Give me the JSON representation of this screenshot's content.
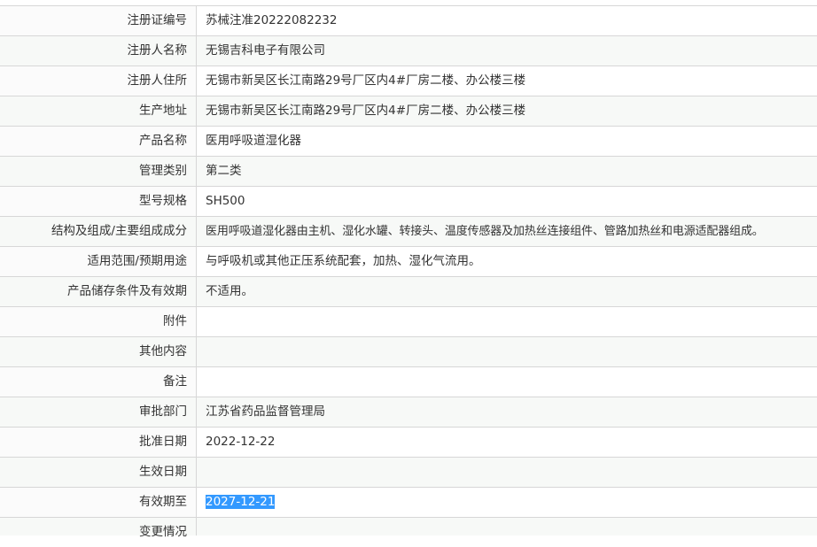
{
  "rows": [
    {
      "label": "注册证编号",
      "value": "苏械注准20222082232"
    },
    {
      "label": "注册人名称",
      "value": "无锡吉科电子有限公司"
    },
    {
      "label": "注册人住所",
      "value": "无锡市新吴区长江南路29号厂区内4#厂房二楼、办公楼三楼"
    },
    {
      "label": "生产地址",
      "value": "无锡市新吴区长江南路29号厂区内4#厂房二楼、办公楼三楼"
    },
    {
      "label": "产品名称",
      "value": "医用呼吸道湿化器"
    },
    {
      "label": "管理类别",
      "value": "第二类"
    },
    {
      "label": "型号规格",
      "value": "SH500"
    },
    {
      "label": "结构及组成/主要组成成分",
      "value": "医用呼吸道湿化器由主机、湿化水罐、转接头、温度传感器及加热丝连接组件、管路加热丝和电源适配器组成。"
    },
    {
      "label": "适用范围/预期用途",
      "value": "与呼吸机或其他正压系统配套，加热、湿化气流用。"
    },
    {
      "label": "产品储存条件及有效期",
      "value": "不适用。"
    },
    {
      "label": "附件",
      "value": ""
    },
    {
      "label": "其他内容",
      "value": ""
    },
    {
      "label": "备注",
      "value": ""
    },
    {
      "label": "审批部门",
      "value": "江苏省药品监督管理局"
    },
    {
      "label": "批准日期",
      "value": "2022-12-22"
    },
    {
      "label": "生效日期",
      "value": ""
    },
    {
      "label": "有效期至",
      "value": "2027-12-21"
    },
    {
      "label": "变更情况",
      "value": ""
    }
  ]
}
